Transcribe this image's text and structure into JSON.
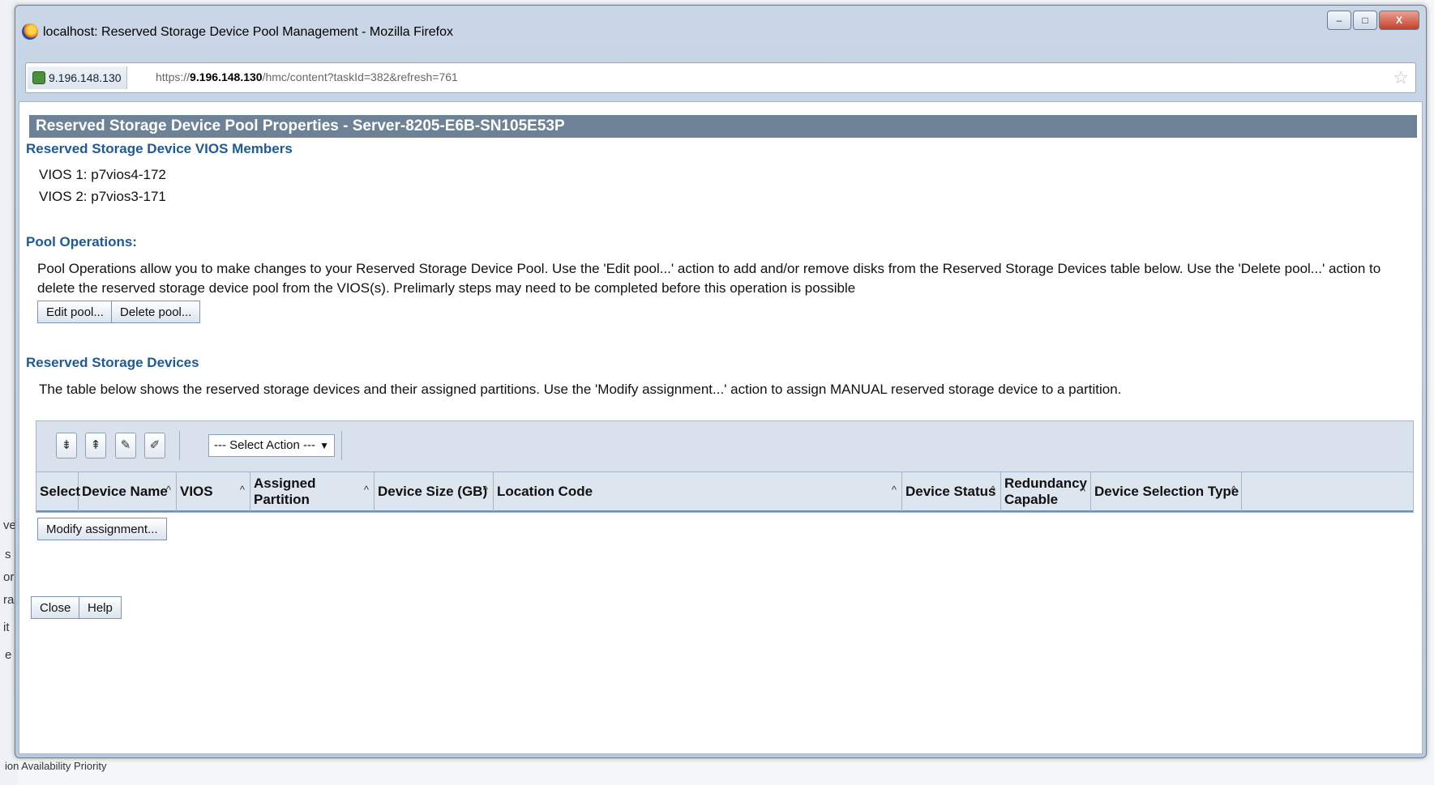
{
  "background": {
    "left_fragments": [
      "ve",
      "s",
      "or",
      "ra",
      "it",
      "e"
    ],
    "bottom_text": "ion Availability Priority"
  },
  "window": {
    "title": "localhost: Reserved Storage Device Pool Management - Mozilla Firefox",
    "controls": {
      "minimize": "–",
      "maximize": "□",
      "close": "X"
    }
  },
  "urlbar": {
    "site_identity": "9.196.148.130",
    "url_prefix": "https://",
    "url_host": "9.196.148.130",
    "url_path": "/hmc/content?taskId=382&refresh=761"
  },
  "page": {
    "header": "Reserved Storage Device Pool Properties - Server-8205-E6B-SN105E53P",
    "vios_section_title": "Reserved Storage Device VIOS Members",
    "vios": [
      {
        "label": "VIOS 1:",
        "value": "p7vios4-172"
      },
      {
        "label": "VIOS 2:",
        "value": "p7vios3-171"
      }
    ],
    "pool_ops_title": "Pool Operations:",
    "pool_ops_text": "Pool Operations allow you to make changes to your Reserved Storage Device Pool. Use the 'Edit pool...' action to add and/or remove disks from the Reserved Storage Devices table below. Use the 'Delete pool...' action to delete the reserved storage device pool from the VIOS(s). Prelimarly steps may need to be completed before this operation is possible",
    "edit_pool_label": "Edit pool...",
    "delete_pool_label": "Delete pool...",
    "devices_title": "Reserved Storage Devices",
    "devices_text": "The table below shows the reserved storage devices and their assigned partitions. Use the 'Modify assignment...' action to assign MANUAL reserved storage device to a partition.",
    "select_action": "--- Select Action ---",
    "columns": [
      "Select",
      "Device Name",
      "VIOS",
      "Assigned Partition",
      "Device Size (GB)",
      "Location Code",
      "Device Status",
      "Redundancy Capable",
      "Device Selection Type"
    ],
    "modify_assignment_label": "Modify assignment...",
    "close_label": "Close",
    "help_label": "Help"
  }
}
